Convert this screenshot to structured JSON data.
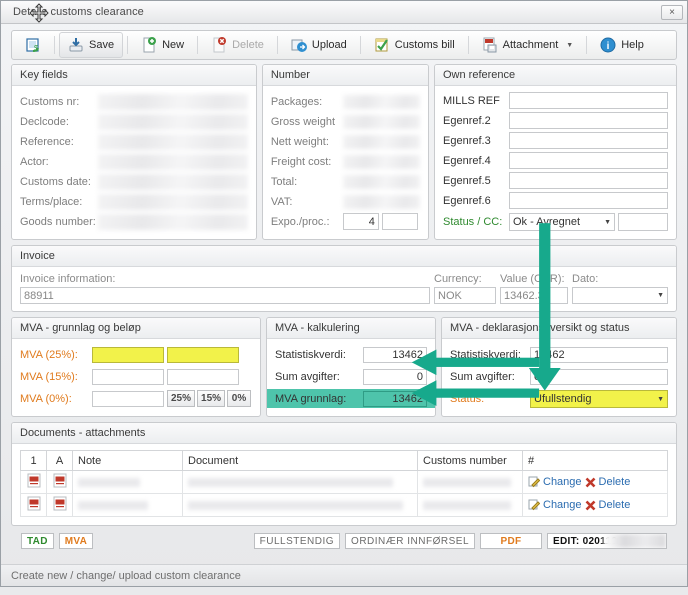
{
  "window": {
    "title": "Details customs clearance",
    "close_label": "×"
  },
  "toolbar": {
    "items": [
      {
        "label": "",
        "icon": "customs-doc-icon",
        "state": "normal"
      },
      {
        "label": "Save",
        "icon": "save-icon",
        "state": "active"
      },
      {
        "label": "New",
        "icon": "new-icon",
        "state": "normal"
      },
      {
        "label": "Delete",
        "icon": "delete-icon",
        "state": "disabled"
      },
      {
        "label": "Upload",
        "icon": "upload-icon",
        "state": "normal"
      },
      {
        "label": "Customs bill",
        "icon": "customs-bill-icon",
        "state": "normal"
      },
      {
        "label": "Attachment",
        "icon": "attachment-icon",
        "state": "normal",
        "has_caret": true
      },
      {
        "label": "Help",
        "icon": "help-icon",
        "state": "normal"
      }
    ]
  },
  "key_fields": {
    "title": "Key fields",
    "rows": [
      {
        "label": "Customs nr:",
        "value": ""
      },
      {
        "label": "Declcode:",
        "value": ""
      },
      {
        "label": "Reference:",
        "value": ""
      },
      {
        "label": "Actor:",
        "value": ""
      },
      {
        "label": "Customs date:",
        "value": ""
      },
      {
        "label": "Terms/place:",
        "value": ""
      },
      {
        "label": "Goods number:",
        "value": ""
      }
    ]
  },
  "number": {
    "title": "Number",
    "rows": [
      {
        "label": "Packages:",
        "value": ""
      },
      {
        "label": "Gross weight",
        "value": ""
      },
      {
        "label": "Nett weight:",
        "value": ""
      },
      {
        "label": "Freight cost:",
        "value": ""
      },
      {
        "label": "Total:",
        "value": ""
      },
      {
        "label": "VAT:",
        "value": ""
      }
    ],
    "expo_label": "Expo./proc.:",
    "expo_value": "4",
    "proc_value": ""
  },
  "own_reference": {
    "title": "Own reference",
    "rows": [
      {
        "label": "MILLS REF",
        "value": ""
      },
      {
        "label": "Egenref.2",
        "value": ""
      },
      {
        "label": "Egenref.3",
        "value": ""
      },
      {
        "label": "Egenref.4",
        "value": ""
      },
      {
        "label": "Egenref.5",
        "value": ""
      },
      {
        "label": "Egenref.6",
        "value": ""
      }
    ],
    "status_label": "Status / CC:",
    "status_value": "Ok - Avregnet",
    "cc_value": ""
  },
  "invoice": {
    "title": "Invoice",
    "information_label": "Invoice information:",
    "information_value": "88911",
    "currency_label": "Currency:",
    "currency_value": "NOK",
    "value_label": "Value (CUR):",
    "value_value": "13462.33",
    "date_label": "Dato:",
    "date_value": ""
  },
  "mva_basis": {
    "title": "MVA - grunnlag og beløp",
    "rows": [
      {
        "label": "MVA (25%):",
        "basis": "",
        "amount": "",
        "highlight": true
      },
      {
        "label": "MVA (15%):",
        "basis": "",
        "amount": "",
        "highlight": false
      },
      {
        "label": "MVA (0%):",
        "basis": "",
        "amount": "",
        "highlight": false
      }
    ],
    "buttons": [
      "25%",
      "15%",
      "0%"
    ]
  },
  "mva_calc": {
    "title": "MVA - kalkulering",
    "rows": [
      {
        "label": "Statistiskverdi:",
        "value": "13462",
        "highlight": false
      },
      {
        "label": "Sum avgifter:",
        "value": "0",
        "highlight": false
      },
      {
        "label": "MVA grunnlag:",
        "value": "13462",
        "highlight": true
      }
    ]
  },
  "mva_status": {
    "title": "MVA - deklarasjonsoversikt og status",
    "rows": [
      {
        "label": "Statistiskverdi:",
        "value": "13462"
      },
      {
        "label": "Sum avgifter:",
        "value": "0"
      }
    ],
    "status_label": "Status:",
    "status_value": "Ufullstendig"
  },
  "documents": {
    "title": "Documents - attachments",
    "columns": [
      "1",
      "A",
      "Note",
      "Document",
      "Customs number",
      "#"
    ],
    "rows": [
      {
        "note": "",
        "document": "",
        "customs_number": "",
        "change_label": "Change",
        "delete_label": "Delete"
      },
      {
        "note": "",
        "document": "",
        "customs_number": "",
        "change_label": "Change",
        "delete_label": "Delete"
      }
    ]
  },
  "bottom": {
    "tad": "TAD",
    "mva": "MVA",
    "fullstendig": "FULLSTENDIG",
    "ordinaer": "ORDINÆR INNFØRSEL",
    "pdf": "PDF",
    "edit": "EDIT: 020110"
  },
  "statusbar": {
    "text": "Create new / change/ upload custom clearance"
  },
  "colors": {
    "accent_teal": "#17a98c",
    "highlight_yellow": "#f2f24a",
    "highlight_teal": "#4ec4ab",
    "label_orange": "#e07b1e",
    "label_green": "#2f8a2f",
    "link_blue": "#2b6cb0"
  }
}
